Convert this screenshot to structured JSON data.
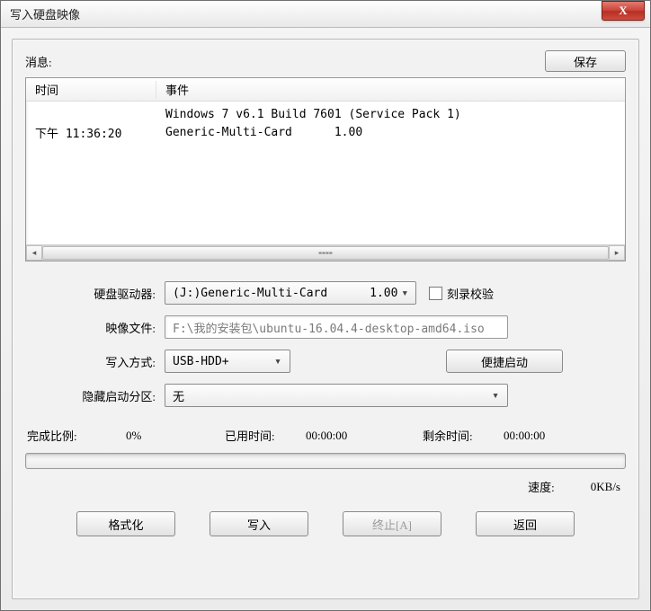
{
  "window": {
    "title": "写入硬盘映像",
    "close_x": "X"
  },
  "panel": {
    "msg_label": "消息:",
    "save_btn": "保存"
  },
  "log": {
    "col_time": "时间",
    "col_event": "事件",
    "rows": [
      {
        "time": "",
        "event": "Windows 7 v6.1 Build 7601 (Service Pack 1)"
      },
      {
        "time": "下午 11:36:20",
        "event": "Generic-Multi-Card      1.00"
      }
    ],
    "thumb_glyph": "╍╍"
  },
  "form": {
    "drive_label": "硬盘驱动器:",
    "drive_value": "(J:)Generic-Multi-Card      1.00",
    "verify_label": "刻录校验",
    "image_label": "映像文件:",
    "image_value": "F:\\我的安装包\\ubuntu-16.04.4-desktop-amd64.iso",
    "method_label": "写入方式:",
    "method_value": "USB-HDD+",
    "quickboot_btn": "便捷启动",
    "hidden_label": "隐藏启动分区:",
    "hidden_value": "无"
  },
  "status": {
    "percent_label": "完成比例:",
    "percent_value": "0%",
    "elapsed_label": "已用时间:",
    "elapsed_value": "00:00:00",
    "remain_label": "剩余时间:",
    "remain_value": "00:00:00",
    "speed_label": "速度:",
    "speed_value": "0KB/s"
  },
  "buttons": {
    "format": "格式化",
    "write": "写入",
    "abort": "终止[A]",
    "back": "返回"
  },
  "glyphs": {
    "caret_down": "▾",
    "tri_left": "◂",
    "tri_right": "▸"
  }
}
